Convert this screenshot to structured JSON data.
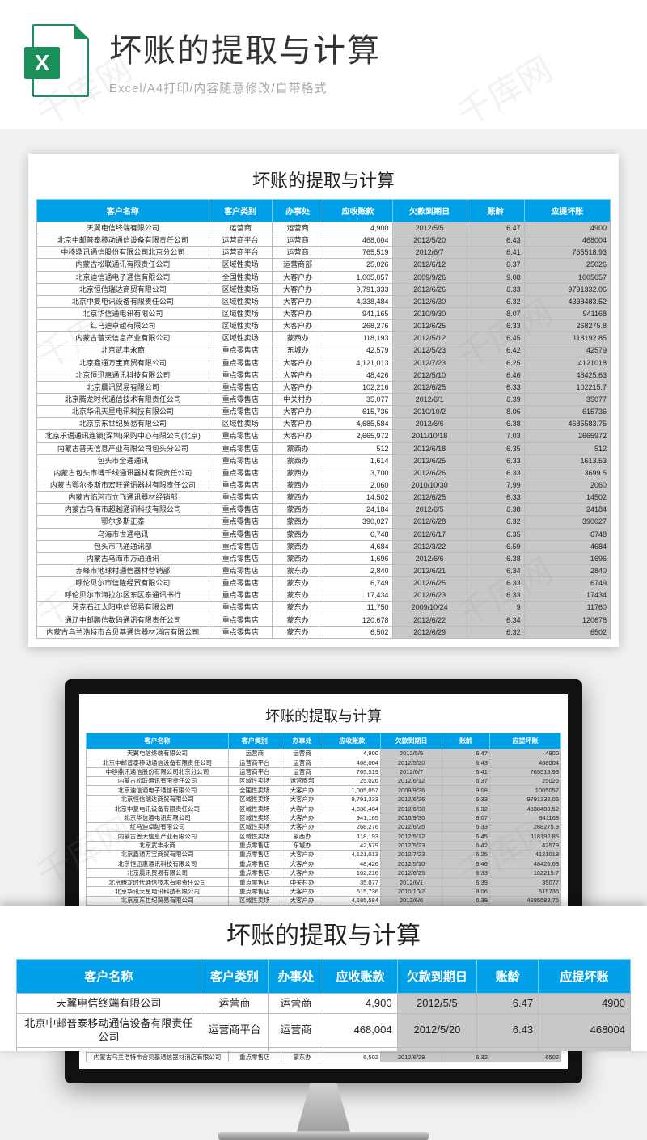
{
  "watermark": "千库网",
  "hero": {
    "title": "坏账的提取与计算",
    "subtitle": "Excel/A4打印/内容随意修改/自带格式",
    "icon_letter": "X"
  },
  "sheet": {
    "title": "坏账的提取与计算",
    "headers": [
      "客户名称",
      "客户类别",
      "办事处",
      "应收账款",
      "欠款到期日",
      "账龄",
      "应提坏账"
    ],
    "rows": [
      [
        "天翼电信终端有限公司",
        "运营商",
        "运营商",
        "4,900",
        "2012/5/5",
        "6.47",
        "4900"
      ],
      [
        "北京中邮普泰移动通信设备有限责任公司",
        "运营商平台",
        "运营商",
        "468,004",
        "2012/5/20",
        "6.43",
        "468004"
      ],
      [
        "中移鼎讯通信股份有限公司北京分公司",
        "运营商平台",
        "运营商",
        "765,519",
        "2012/6/7",
        "6.41",
        "765518.93"
      ],
      [
        "内蒙古松联通讯有限责任公司",
        "区域性卖场",
        "运营商部",
        "25,026",
        "2012/6/12",
        "6.37",
        "25026"
      ],
      [
        "北京迪信通电子通信有限公司",
        "全国性卖场",
        "大客户办",
        "1,005,057",
        "2009/9/26",
        "9.08",
        "1005057"
      ],
      [
        "北京恒信瑞达商贸有限公司",
        "区域性卖场",
        "大客户办",
        "9,791,333",
        "2012/6/26",
        "6.33",
        "9791332.06"
      ],
      [
        "北京中复电讯设备有限责任公司",
        "区域性卖场",
        "大客户办",
        "4,338,484",
        "2012/6/30",
        "6.32",
        "4338483.52"
      ],
      [
        "北京华信通电讯有限公司",
        "区域性卖场",
        "大客户办",
        "941,165",
        "2010/9/30",
        "8.07",
        "941168"
      ],
      [
        "红马迪卓越有限公司",
        "区域性卖场",
        "大客户办",
        "268,276",
        "2012/6/25",
        "6.33",
        "268275.8"
      ],
      [
        "内蒙古普天信息产业有限公司",
        "区域性卖场",
        "蒙西办",
        "118,193",
        "2012/5/12",
        "6.45",
        "118192.85"
      ],
      [
        "北京武丰永商",
        "重点零售店",
        "东城办",
        "42,579",
        "2012/5/23",
        "6.42",
        "42579"
      ],
      [
        "北京鑫通万宝商贸有限公司",
        "重点零售店",
        "大客户办",
        "4,121,013",
        "2012/7/23",
        "6.25",
        "4121018"
      ],
      [
        "北京恒迅惠通讯科技有限公司",
        "重点零售店",
        "大客户办",
        "48,426",
        "2012/5/10",
        "6.46",
        "48425.63"
      ],
      [
        "北京晨讯贸易有限公司",
        "重点零售店",
        "大客户办",
        "102,216",
        "2012/6/25",
        "6.33",
        "102215.7"
      ],
      [
        "北京腾龙时代通信技术有限责任公司",
        "重点零售店",
        "中关村办",
        "35,077",
        "2012/6/1",
        "6.39",
        "35077"
      ],
      [
        "北京华讯天星电讯科技有限公司",
        "重点零售店",
        "大客户办",
        "615,736",
        "2010/10/2",
        "8.06",
        "615736"
      ],
      [
        "北京京东世纪贸易有限公司",
        "区域性卖场",
        "大客户办",
        "4,685,584",
        "2012/6/6",
        "6.38",
        "4685583.75"
      ],
      [
        "北京乐语通讯连锁(深圳)采购中心有限公司(北京)",
        "重点零售店",
        "大客户办",
        "2,665,972",
        "2011/10/18",
        "7.03",
        "2665972"
      ],
      [
        "内蒙古普天信息产业有限公司包头分公司",
        "重点零售店",
        "蒙西办",
        "512",
        "2012/6/18",
        "6.35",
        "512"
      ],
      [
        "包头市全通通讯",
        "重点零售店",
        "蒙西办",
        "1,614",
        "2012/6/25",
        "6.33",
        "1613.53"
      ],
      [
        "内蒙古包头市博千线通讯器材有限责任公司",
        "重点零售店",
        "蒙西办",
        "3,700",
        "2012/6/26",
        "6.33",
        "3699.5"
      ],
      [
        "内蒙古鄂尔多斯市宏旺通讯器材有限责任公司",
        "重点零售店",
        "蒙西办",
        "2,060",
        "2010/10/30",
        "7.99",
        "2060"
      ],
      [
        "内蒙古临河市立飞通讯器材经销部",
        "重点零售店",
        "蒙西办",
        "14,502",
        "2012/6/25",
        "6.33",
        "14502"
      ],
      [
        "内蒙古乌海市超越通讯科技有限公司",
        "重点零售店",
        "蒙西办",
        "24,184",
        "2012/6/5",
        "6.38",
        "24184"
      ],
      [
        "鄂尔多斯正泰",
        "重点零售店",
        "蒙西办",
        "390,027",
        "2012/6/28",
        "6.32",
        "390027"
      ],
      [
        "乌海市世通电讯",
        "重点零售店",
        "蒙西办",
        "6,748",
        "2012/6/17",
        "6.35",
        "6748"
      ],
      [
        "包头市飞通通讯部",
        "重点零售店",
        "蒙西办",
        "4,684",
        "2012/3/22",
        "6.59",
        "4684"
      ],
      [
        "内蒙古乌海市万通通讯",
        "重点零售店",
        "蒙西办",
        "1,696",
        "2012/6/6",
        "6.38",
        "1696"
      ],
      [
        "赤峰市地球村通信器材营销部",
        "重点零售店",
        "蒙东办",
        "2,840",
        "2012/6/21",
        "6.34",
        "2840"
      ],
      [
        "呼伦贝尔市信隆经贸有限公司",
        "重点零售店",
        "蒙东办",
        "6,749",
        "2012/6/25",
        "6.33",
        "6749"
      ],
      [
        "呼伦贝尔市海拉尔区东区泰通讯书行",
        "重点零售店",
        "蒙东办",
        "17,434",
        "2012/6/23",
        "6.33",
        "17434"
      ],
      [
        "牙克石红太阳电信贸易有限公司",
        "重点零售店",
        "蒙东办",
        "11,750",
        "2009/10/24",
        "9",
        "11760"
      ],
      [
        "通辽中邮鹏信数码通讯有限责任公司",
        "重点零售店",
        "蒙东办",
        "120,678",
        "2012/6/22",
        "6.34",
        "120678"
      ],
      [
        "内蒙古乌兰浩特市合贝基通信器材消店有限公司",
        "重点零售店",
        "蒙东办",
        "6,502",
        "2012/6/29",
        "6.32",
        "6502"
      ]
    ]
  }
}
